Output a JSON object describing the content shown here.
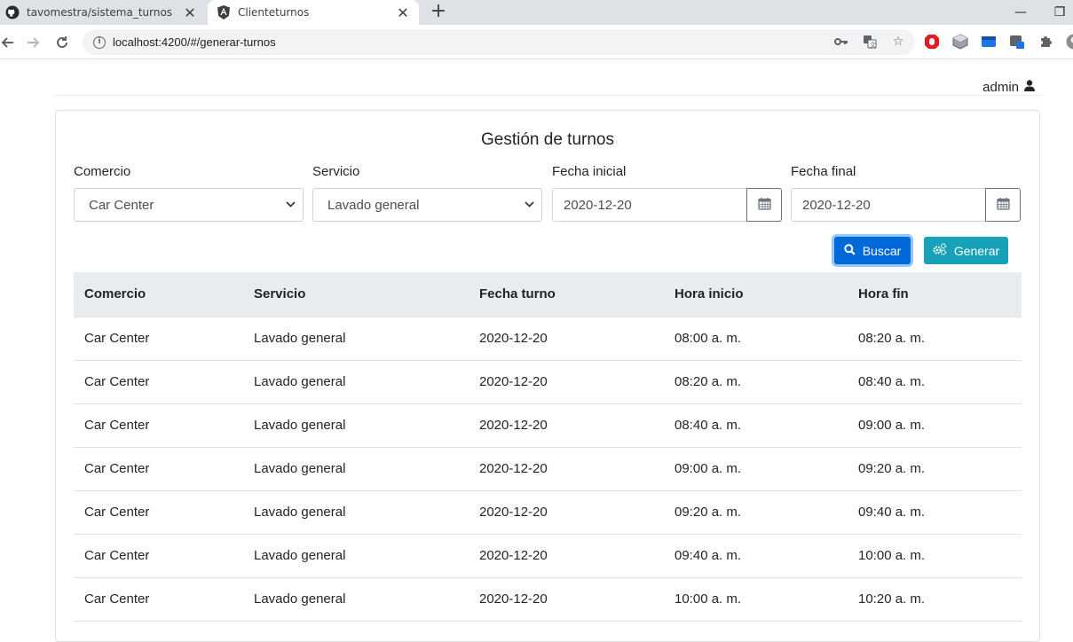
{
  "browser": {
    "tabs": [
      {
        "title": "tavomestra/sistema_turnos",
        "icon": "github-icon"
      },
      {
        "title": "Clienteturnos",
        "icon": "angular-icon"
      }
    ],
    "url_host": "localhost",
    "url_rest": ":4200/#/generar-turnos"
  },
  "header": {
    "user": "admin"
  },
  "page": {
    "title": "Gestión de turnos",
    "filters": {
      "comercio_label": "Comercio",
      "comercio_value": "Car Center",
      "servicio_label": "Servicio",
      "servicio_value": "Lavado general",
      "fecha_inicial_label": "Fecha inicial",
      "fecha_inicial_value": "2020-12-20",
      "fecha_final_label": "Fecha final",
      "fecha_final_value": "2020-12-20"
    },
    "buttons": {
      "buscar": "Buscar",
      "generar": "Generar"
    },
    "table": {
      "headers": [
        "Comercio",
        "Servicio",
        "Fecha turno",
        "Hora inicio",
        "Hora fin"
      ],
      "rows": [
        [
          "Car Center",
          "Lavado general",
          "2020-12-20",
          "08:00 a. m.",
          "08:20 a. m."
        ],
        [
          "Car Center",
          "Lavado general",
          "2020-12-20",
          "08:20 a. m.",
          "08:40 a. m."
        ],
        [
          "Car Center",
          "Lavado general",
          "2020-12-20",
          "08:40 a. m.",
          "09:00 a. m."
        ],
        [
          "Car Center",
          "Lavado general",
          "2020-12-20",
          "09:00 a. m.",
          "09:20 a. m."
        ],
        [
          "Car Center",
          "Lavado general",
          "2020-12-20",
          "09:20 a. m.",
          "09:40 a. m."
        ],
        [
          "Car Center",
          "Lavado general",
          "2020-12-20",
          "09:40 a. m.",
          "10:00 a. m."
        ],
        [
          "Car Center",
          "Lavado general",
          "2020-12-20",
          "10:00 a. m.",
          "10:20 a. m."
        ]
      ]
    }
  },
  "colors": {
    "primary": "#0069d9",
    "info": "#17a2b8",
    "table_header_bg": "#e9ecef"
  }
}
